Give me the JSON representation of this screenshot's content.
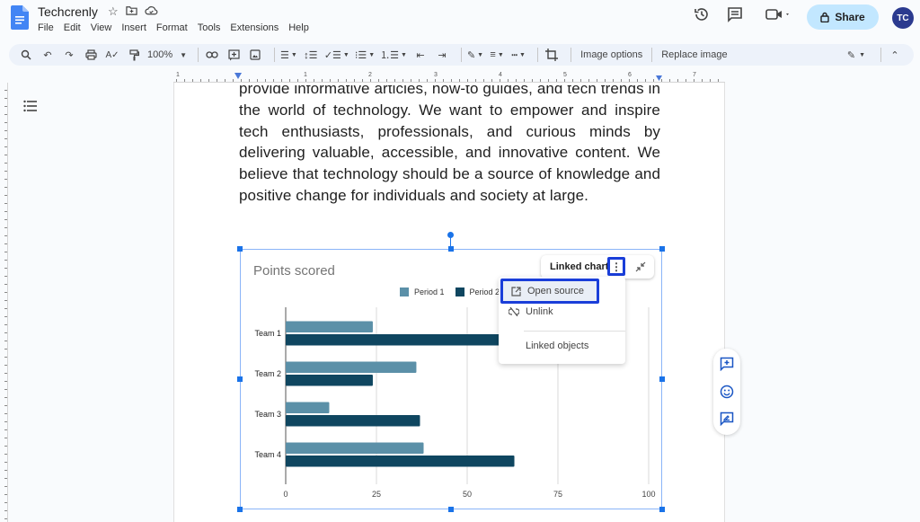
{
  "app": {
    "doc_title": "Techcrenly",
    "title_icons": [
      "star-icon",
      "move-to-folder-icon",
      "cloud-saved-icon"
    ],
    "menu": [
      "File",
      "Edit",
      "View",
      "Insert",
      "Format",
      "Tools",
      "Extensions",
      "Help"
    ],
    "share_label": "Share",
    "avatar_initials": "TC"
  },
  "toolbar": {
    "zoom": "100%",
    "image_options": "Image options",
    "replace_image": "Replace image"
  },
  "ruler": {
    "numbers": [
      "1",
      "1",
      "2",
      "3",
      "4",
      "5",
      "6",
      "7"
    ]
  },
  "document": {
    "paragraph": "provide informative articles, how-to guides, and tech trends in the world of technology. We want to empower and inspire tech enthusiasts, professionals, and curious minds by delivering valuable, accessible, and innovative content. We believe that technology should be a source of knowledge and positive change for individuals and society at large."
  },
  "linked_chart": {
    "chip_label": "Linked chart",
    "menu": [
      {
        "label": "Open source",
        "icon": "open-in-new-icon"
      },
      {
        "label": "Unlink",
        "icon": "link-off-icon"
      },
      {
        "label": "Linked objects",
        "icon": ""
      }
    ]
  },
  "colors": {
    "period1": "#5b90a8",
    "period2": "#0f4660",
    "accent": "#1a73e8",
    "highlight": "#1a3ed9"
  },
  "chart_data": {
    "type": "bar",
    "orientation": "horizontal",
    "title": "Points scored",
    "categories": [
      "Team 1",
      "Team 2",
      "Team 3",
      "Team 4"
    ],
    "series": [
      {
        "name": "Period 1",
        "values": [
          24,
          36,
          12,
          38
        ]
      },
      {
        "name": "Period 2",
        "values": [
          60,
          24,
          37,
          63
        ]
      }
    ],
    "legend_labels": [
      "Period 1",
      "Period 2"
    ],
    "legend_position": "top",
    "xticks": [
      "0",
      "25",
      "50",
      "75",
      "100"
    ],
    "xlim": [
      0,
      100
    ],
    "grid": true,
    "xlabel": "",
    "ylabel": ""
  }
}
